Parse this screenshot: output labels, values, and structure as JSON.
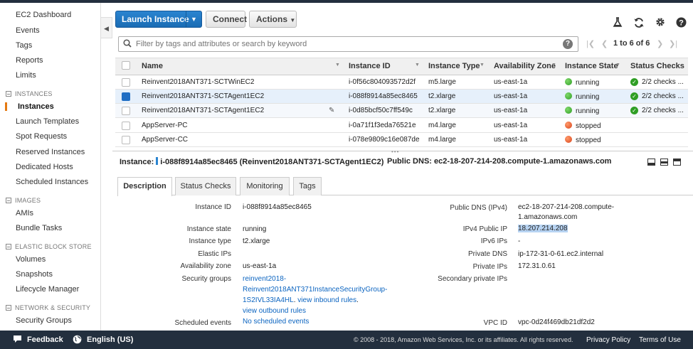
{
  "sidebar": {
    "top_items": [
      "EC2 Dashboard",
      "Events",
      "Tags",
      "Reports",
      "Limits"
    ],
    "sections": [
      {
        "title": "INSTANCES",
        "items": [
          "Instances",
          "Launch Templates",
          "Spot Requests",
          "Reserved Instances",
          "Dedicated Hosts",
          "Scheduled Instances"
        ]
      },
      {
        "title": "IMAGES",
        "items": [
          "AMIs",
          "Bundle Tasks"
        ]
      },
      {
        "title": "ELASTIC BLOCK STORE",
        "items": [
          "Volumes",
          "Snapshots",
          "Lifecycle Manager"
        ]
      },
      {
        "title": "NETWORK & SECURITY",
        "items": [
          "Security Groups"
        ]
      }
    ],
    "active_item": "Instances"
  },
  "toolbar": {
    "launch_label": "Launch Instance",
    "connect_label": "Connect",
    "actions_label": "Actions"
  },
  "search": {
    "placeholder": "Filter by tags and attributes or search by keyword"
  },
  "pager": {
    "text": "1 to 6 of 6"
  },
  "table": {
    "columns": [
      "Name",
      "Instance ID",
      "Instance Type",
      "Availability Zone",
      "Instance State",
      "Status Checks"
    ],
    "rows": [
      {
        "name": "Reinvent2018ANT371-SCTWinEC2",
        "id": "i-0f56c804093572d2f",
        "type": "m5.large",
        "az": "us-east-1a",
        "state": "running",
        "checks": "2/2 checks ...",
        "selected": false
      },
      {
        "name": "Reinvent2018ANT371-SCTAgent1EC2",
        "id": "i-088f8914a85ec8465",
        "type": "t2.xlarge",
        "az": "us-east-1a",
        "state": "running",
        "checks": "2/2 checks ...",
        "selected": true
      },
      {
        "name": "Reinvent2018ANT371-SCTAgent1EC2",
        "id": "i-0d85bcf50c7ff549c",
        "type": "t2.xlarge",
        "az": "us-east-1a",
        "state": "running",
        "checks": "2/2 checks ...",
        "selected": false
      },
      {
        "name": "AppServer-PC",
        "id": "i-0a71f1f3eda76521e",
        "type": "m4.large",
        "az": "us-east-1a",
        "state": "stopped",
        "checks": "",
        "selected": false
      },
      {
        "name": "AppServer-CC",
        "id": "i-078e9809c16e087de",
        "type": "m4.large",
        "az": "us-east-1a",
        "state": "stopped",
        "checks": "",
        "selected": false
      }
    ]
  },
  "details": {
    "instance_label": "Instance:",
    "instance_value": "i-088f8914a85ec8465 (Reinvent2018ANT371-SCTAgent1EC2)",
    "dns_label": "Public DNS:",
    "dns_value": "ec2-18-207-214-208.compute-1.amazonaws.com",
    "tabs": [
      "Description",
      "Status Checks",
      "Monitoring",
      "Tags"
    ]
  },
  "description": {
    "instance_id_label": "Instance ID",
    "instance_id": "i-088f8914a85ec8465",
    "state_label": "Instance state",
    "state": "running",
    "type_label": "Instance type",
    "type": "t2.xlarge",
    "eips_label": "Elastic IPs",
    "eips": "",
    "az_label": "Availability zone",
    "az": "us-east-1a",
    "sg_label": "Security groups",
    "sg_line1": "reinvent2018-",
    "sg_line2": "Reinvent2018ANT371InstanceSecurityGroup-",
    "sg_line3": "1S2IVL33IA4HL",
    "sg_sep": ".",
    "sg_view_inbound": "view inbound rules",
    "sg_dot": ".",
    "sg_view_outbound": "view outbound rules",
    "sched_label": "Scheduled events",
    "sched": "No scheduled events",
    "pub_dns_label": "Public DNS (IPv4)",
    "pub_dns_line1": "ec2-18-207-214-208.compute-",
    "pub_dns_line2": "1.amazonaws.com",
    "ipv4_label": "IPv4 Public IP",
    "ipv4": "18.207.214.208",
    "ipv6_label": "IPv6 IPs",
    "ipv6": "-",
    "priv_dns_label": "Private DNS",
    "priv_dns": "ip-172-31-0-61.ec2.internal",
    "priv_ips_label": "Private IPs",
    "priv_ips": "172.31.0.61",
    "sec_priv_label": "Secondary private IPs",
    "sec_priv": "",
    "vpc_label": "VPC ID",
    "vpc": "vpc-0d24f469db21df2d2"
  },
  "footer": {
    "feedback": "Feedback",
    "language": "English (US)",
    "copyright": "© 2008 - 2018, Amazon Web Services, Inc. or its affiliates. All rights reserved.",
    "privacy": "Privacy Policy",
    "terms": "Terms of Use"
  },
  "colors": {
    "accent": "#1f6ec4",
    "nav_dark": "#232f3e",
    "active_marker": "#e47911",
    "running": "#2f9e24",
    "stopped": "#d8441b"
  }
}
